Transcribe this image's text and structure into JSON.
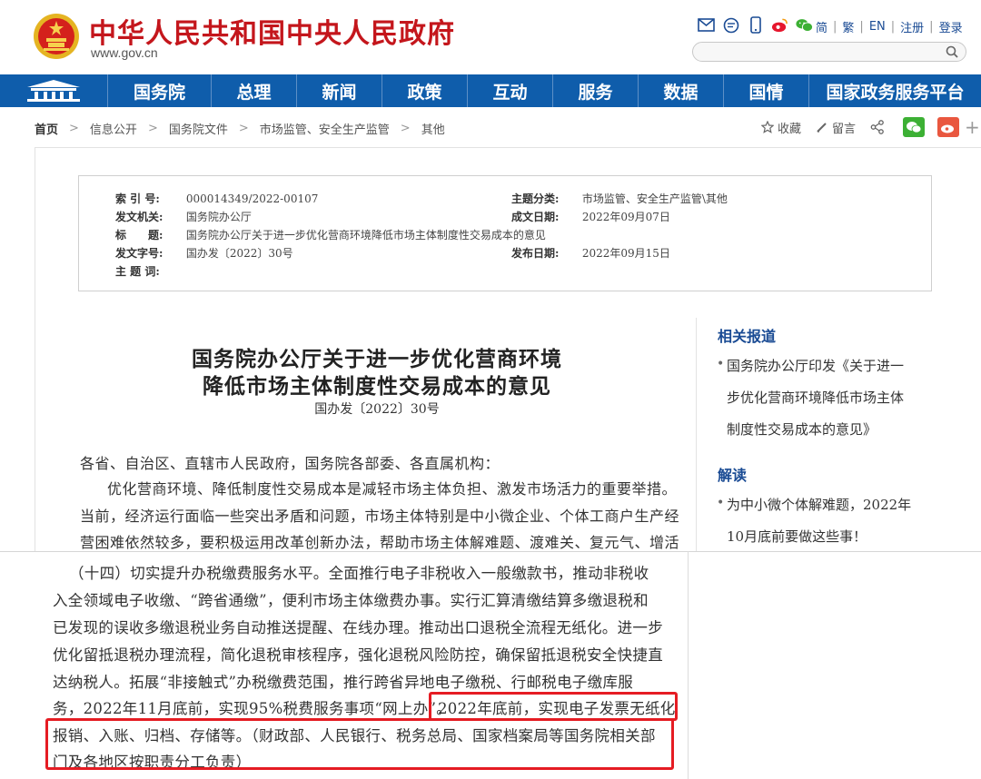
{
  "header": {
    "site_name": "中华人民共和国中央人民政府",
    "site_url": "www.gov.cn",
    "icons": [
      "mail-icon",
      "chat-icon",
      "mobile-icon",
      "weibo-icon",
      "wechat-icon"
    ],
    "lang_links": [
      "简",
      "繁",
      "EN",
      "注册",
      "登录"
    ]
  },
  "nav": {
    "items": [
      "国务院",
      "总理",
      "新闻",
      "政策",
      "互动",
      "服务",
      "数据",
      "国情",
      "国家政务服务平台"
    ]
  },
  "breadcrumb": {
    "items": [
      "首页",
      "信息公开",
      "国务院文件",
      "市场监管、安全生产监管",
      "其他"
    ],
    "collect_label": "收藏",
    "comment_label": "留言"
  },
  "meta": {
    "index_label": "索 引 号:",
    "index_value": "000014349/2022-00107",
    "issuer_label": "发文机关:",
    "issuer_value": "国务院办公厅",
    "title_label": "标　　题:",
    "title_value": "国务院办公厅关于进一步优化营商环境降低市场主体制度性交易成本的意见",
    "docno_label": "发文字号:",
    "docno_value": "国办发〔2022〕30号",
    "keywords_label": "主 题 词:",
    "category_label": "主题分类:",
    "category_value": "市场监管、安全生产监管\\其他",
    "created_label": "成文日期:",
    "created_value": "2022年09月07日",
    "published_label": "发布日期:",
    "published_value": "2022年09月15日"
  },
  "document": {
    "title_line1": "国务院办公厅关于进一步优化营商环境",
    "title_line2": "降低市场主体制度性交易成本的意见",
    "doc_no": "国办发〔2022〕30号",
    "salutation": "各省、自治区、直辖市人民政府，国务院各部委、各直属机构：",
    "para_lines": [
      "优化营商环境、降低制度性交易成本是减轻市场主体负担、激发市场活力的重要举措。",
      "当前，经济运行面临一些突出矛盾和问题，市场主体特别是中小微企业、个体工商户生产经",
      "营困难依然较多，要积极运用改革创新办法，帮助市场主体解难题、渡难关、复元气、增活"
    ]
  },
  "sidebar": {
    "related_title": "相关报道",
    "related_lines": [
      "国务院办公厅印发《关于进一",
      "步优化营商环境降低市场主体",
      "制度性交易成本的意见》"
    ],
    "interpret_title": "解读",
    "interpret_lines": [
      "为中小微个体解难题，2022年",
      "10月底前要做这些事！"
    ]
  },
  "clip": {
    "lines": [
      "（十四）切实提升办税缴费服务水平。全面推行电子非税收入一般缴款书，推动非税收",
      "入全领域电子收缴、“跨省通缴”，便利市场主体缴费办事。实行汇算清缴结算多缴退税和",
      "已发现的误收多缴退税业务自动推送提醒、在线办理。推动出口退税全流程无纸化。进一步",
      "优化留抵退税办理流程，简化退税审核程序，强化退税风险防控，确保留抵退税安全快捷直",
      "达纳税人。拓展“非接触式”办税缴费范围，推行跨省异地电子缴税、行邮税电子缴库服",
      "务，2022年11月底前，实现95%税费服务事项“网上办”。",
      "报销、入账、归档、存储等。（财政部、人民银行、税务总局、国家档案局等国务院相关部",
      "门及各地区按职责分工负责）"
    ],
    "highlight_inline": "2022年底前，实现电子发票无纸化"
  },
  "colors": {
    "brand_red": "#c4161c",
    "nav_blue": "#0f5dab",
    "link_blue": "#1a4b94",
    "highlight_red": "#e51c23"
  }
}
